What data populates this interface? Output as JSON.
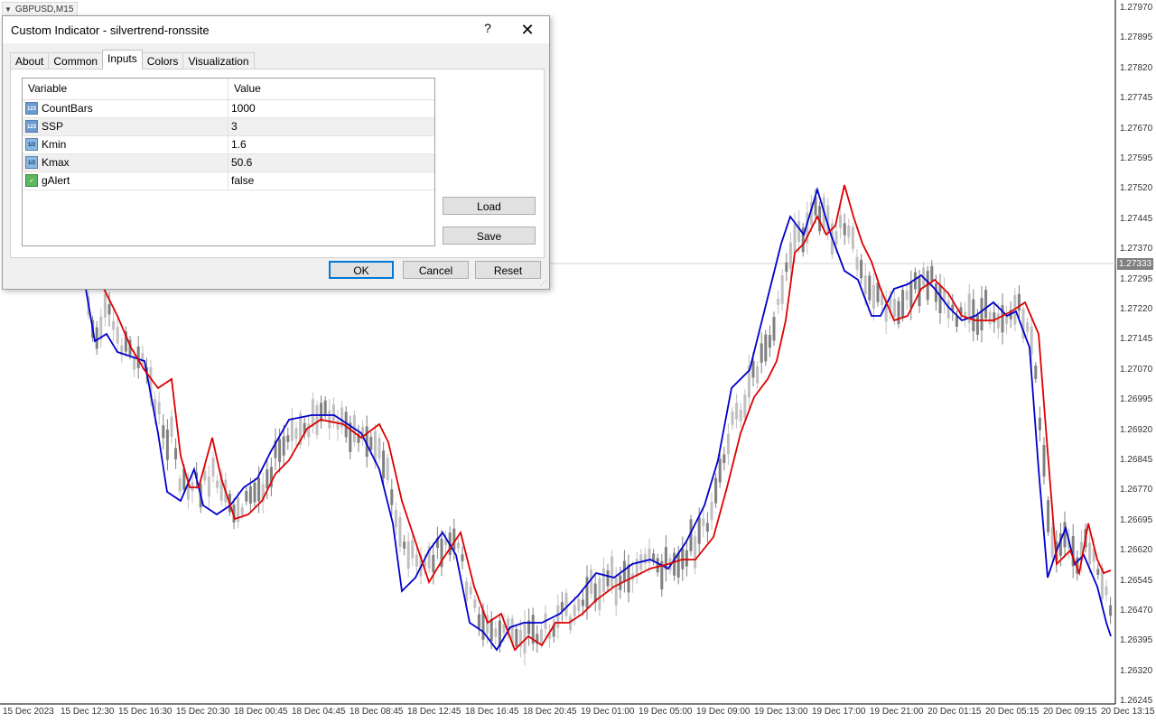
{
  "chart": {
    "symbol": "GBPUSD,M15",
    "current_price": "1.27333",
    "price_scale": [
      "1.27970",
      "1.27895",
      "1.27820",
      "1.27745",
      "1.27670",
      "1.27595",
      "1.27520",
      "1.27445",
      "1.27370",
      "1.27295",
      "1.27220",
      "1.27145",
      "1.27070",
      "1.26995",
      "1.26920",
      "1.26845",
      "1.26770",
      "1.26695",
      "1.26620",
      "1.26545",
      "1.26470",
      "1.26395",
      "1.26320",
      "1.26245"
    ],
    "time_scale": [
      "15 Dec 2023",
      "15 Dec 12:30",
      "15 Dec 16:30",
      "15 Dec 20:30",
      "18 Dec 00:45",
      "18 Dec 04:45",
      "18 Dec 08:45",
      "18 Dec 12:45",
      "18 Dec 16:45",
      "18 Dec 20:45",
      "19 Dec 01:00",
      "19 Dec 05:00",
      "19 Dec 09:00",
      "19 Dec 13:00",
      "19 Dec 17:00",
      "19 Dec 21:00",
      "20 Dec 01:15",
      "20 Dec 05:15",
      "20 Dec 09:15",
      "20 Dec 13:15"
    ],
    "colors": {
      "fast_line": "#0000cc",
      "slow_line": "#dd0000",
      "candle": "#808080",
      "candle_light": "#c0c0c0",
      "grid_line": "#d0d0d0"
    }
  },
  "dialog": {
    "title": "Custom Indicator - silvertrend-ronssite",
    "help_label": "?",
    "close_icon": "close-icon",
    "tabs": [
      "About",
      "Common",
      "Inputs",
      "Colors",
      "Visualization"
    ],
    "active_tab": "Inputs",
    "grid": {
      "headers": [
        "Variable",
        "Value"
      ],
      "rows": [
        {
          "name": "CountBars",
          "value": "1000",
          "type": "int"
        },
        {
          "name": "SSP",
          "value": "3",
          "type": "int"
        },
        {
          "name": "Kmin",
          "value": "1.6",
          "type": "double"
        },
        {
          "name": "Kmax",
          "value": "50.6",
          "type": "double"
        },
        {
          "name": "gAlert",
          "value": "false",
          "type": "bool"
        }
      ]
    },
    "buttons": {
      "load": "Load",
      "save": "Save",
      "ok": "OK",
      "cancel": "Cancel",
      "reset": "Reset"
    },
    "icon_labels": {
      "int": "123",
      "double": "1/2"
    }
  }
}
